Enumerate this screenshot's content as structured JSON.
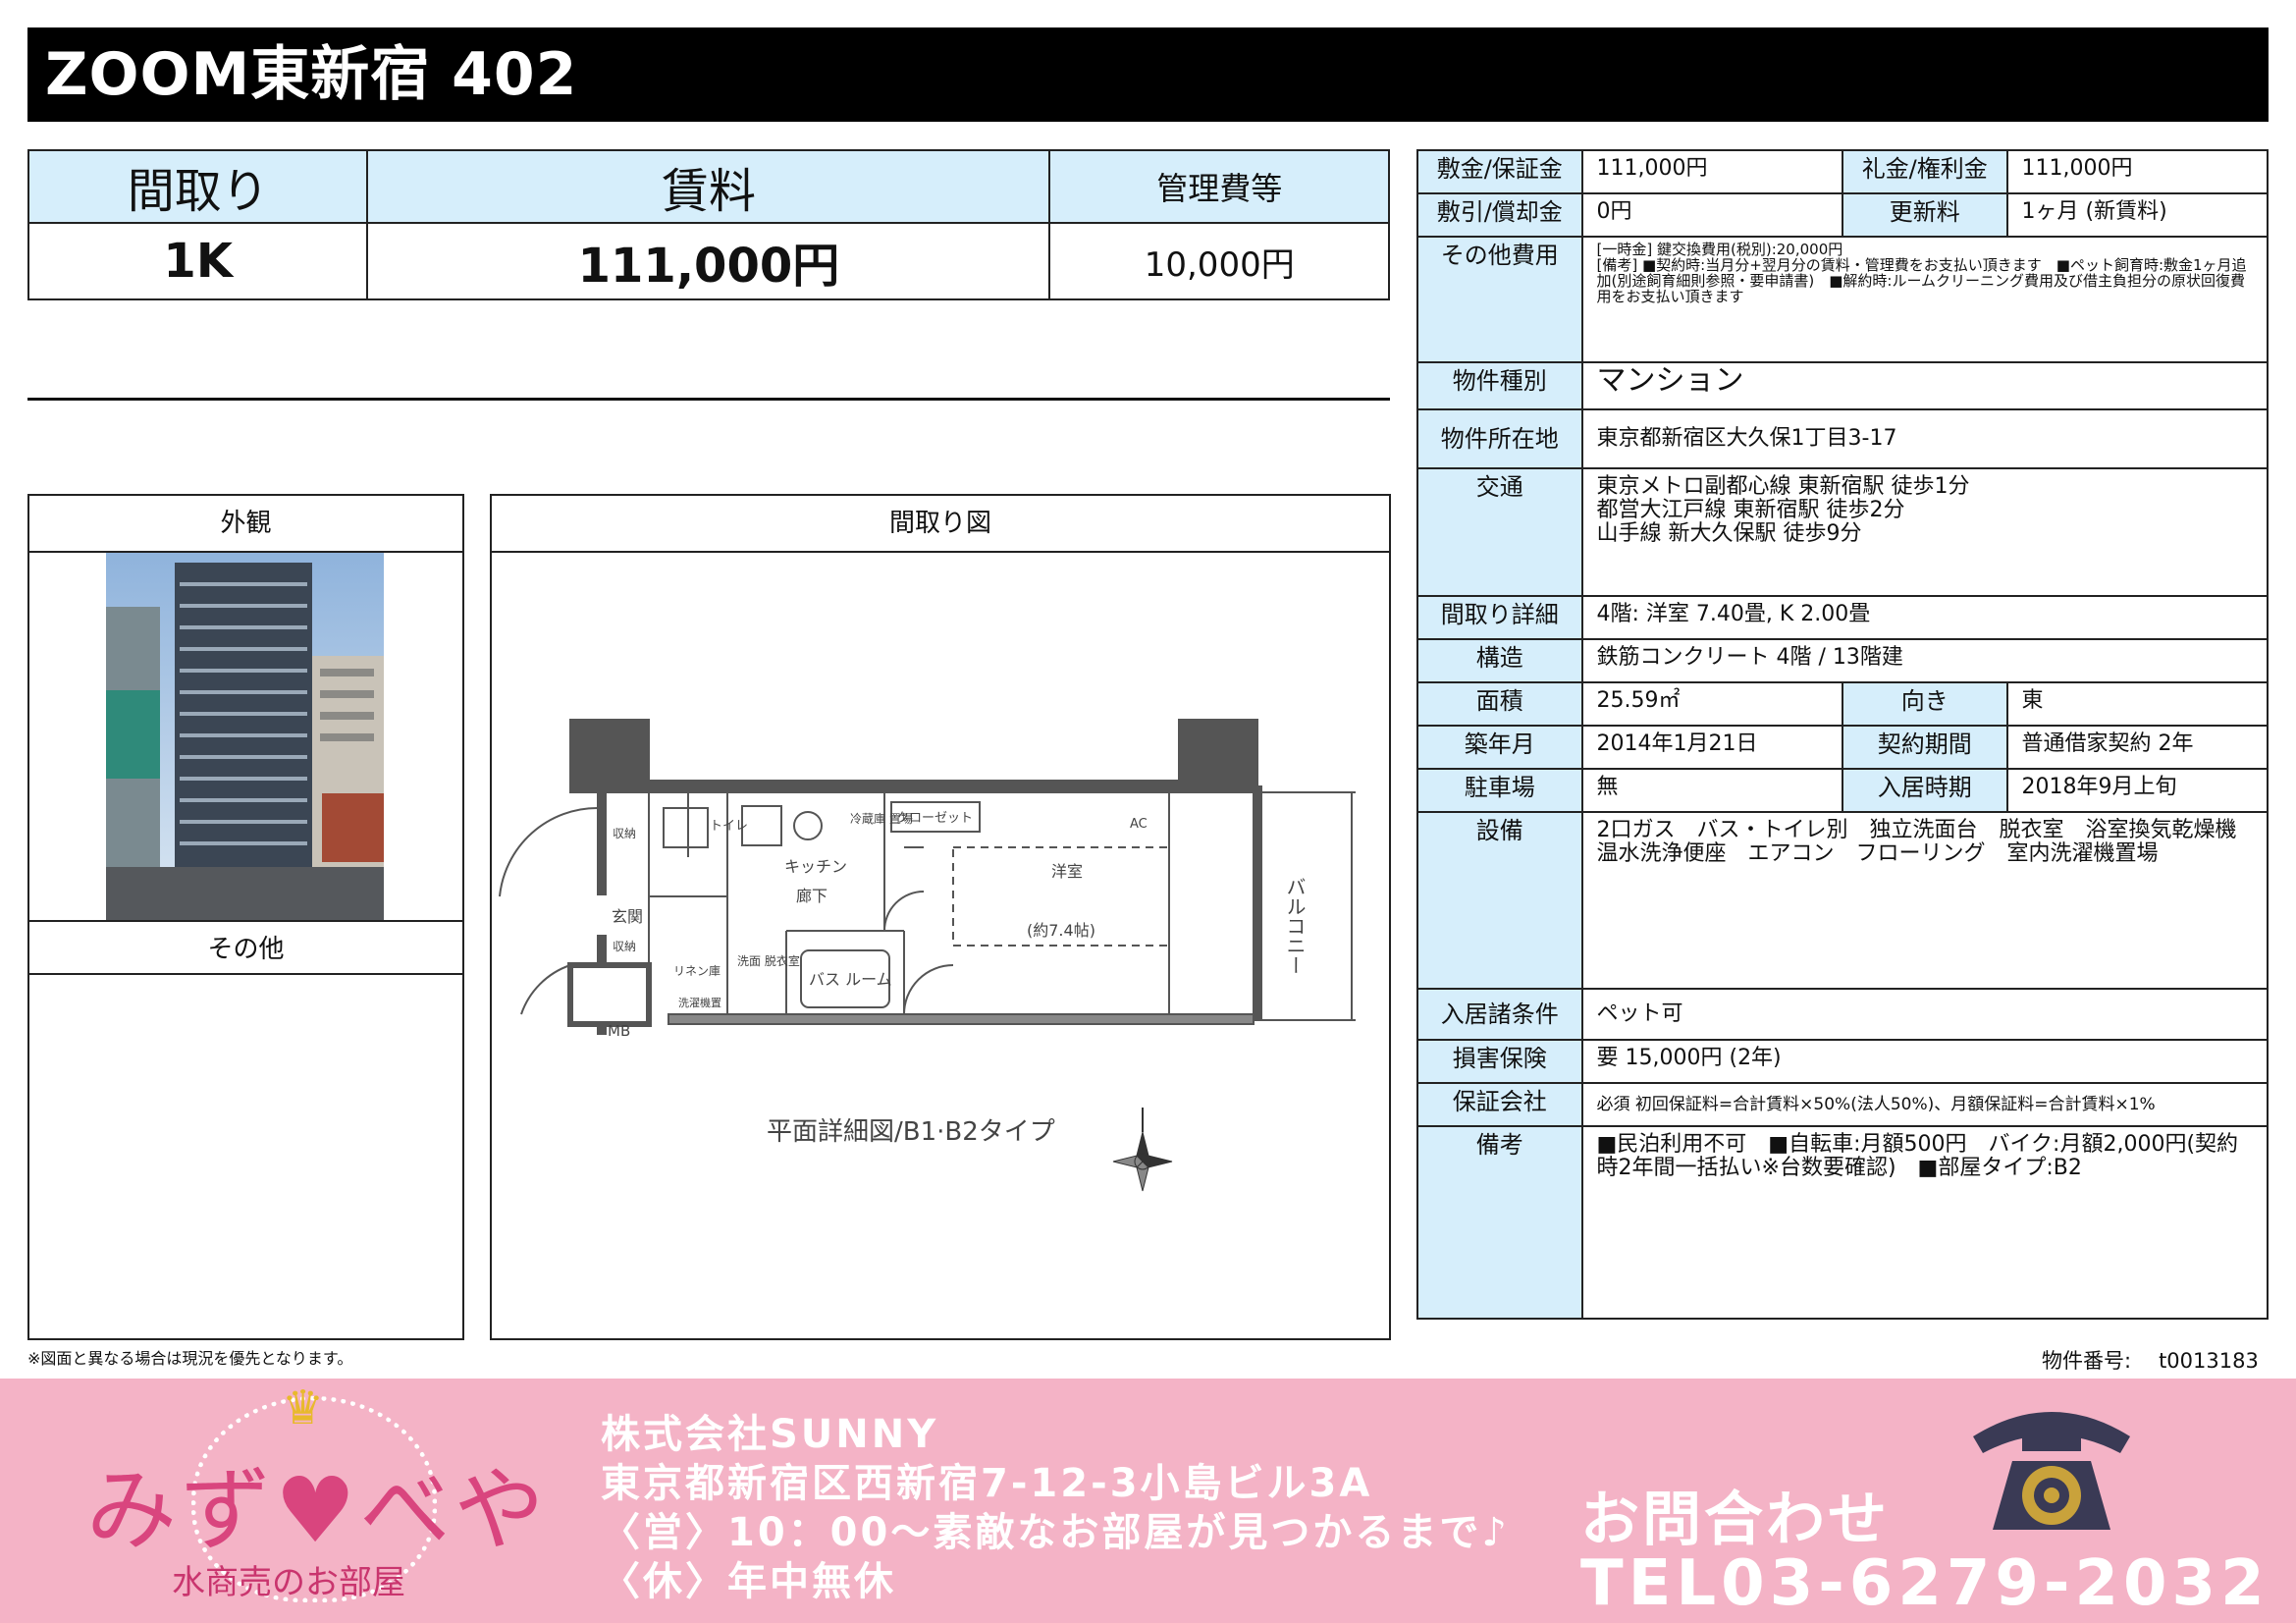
{
  "title": "ZOOM東新宿 402",
  "price": {
    "layout_label": "間取り",
    "rent_label": "賃料",
    "fee_label": "管理費等",
    "layout_value": "1K",
    "rent_value": "111,000円",
    "fee_value": "10,000円"
  },
  "panels": {
    "exterior": "外観",
    "other": "その他",
    "floorplan": "間取り図"
  },
  "floorplan": {
    "caption": "平面詳細図/B1·B2タイプ",
    "labels": {
      "kitchen": "キッチン",
      "hall": "廊下",
      "western": "洋室",
      "western_size": "(約7.4帖)",
      "closet": "クローゼット",
      "bath": "バス\nルーム",
      "entrance": "玄関",
      "toilet": "トイレ",
      "balcony": "バルコニー",
      "mb": "MB",
      "storage1": "収納",
      "storage2": "収納",
      "fridge": "冷蔵庫\n置場",
      "linen": "リネン庫",
      "washroom": "洗面\n脱衣室",
      "washer": "洗濯機置",
      "ac": "AC"
    }
  },
  "note": "※図面と異なる場合は現況を優先となります。",
  "property_no_label": "物件番号:",
  "property_no": "t0013183",
  "details": {
    "deposit_label": "敷金/保証金",
    "deposit": "111,000円",
    "key_money_label": "礼金/権利金",
    "key_money": "111,000円",
    "deduction_label": "敷引/償却金",
    "deduction": "0円",
    "renewal_label": "更新料",
    "renewal": "1ヶ月 (新賃料)",
    "other_cost_label": "その他費用",
    "other_cost_1": "[一時金] 鍵交換費用(税別):20,000円",
    "other_cost_2": "[備考] ■契約時:当月分+翌月分の賃料・管理費をお支払い頂きます　■ペット飼育時:敷金1ヶ月追加(別途飼育細則参照・要申請書)　■解約時:ルームクリーニング費用及び借主負担分の原状回復費用をお支払い頂きます",
    "type_label": "物件種別",
    "type": "マンション",
    "location_label": "物件所在地",
    "location": "東京都新宿区大久保1丁目3-17",
    "transport_label": "交通",
    "transport_1": "東京メトロ副都心線 東新宿駅 徒歩1分",
    "transport_2": "都営大江戸線 東新宿駅 徒歩2分",
    "transport_3": "山手線 新大久保駅 徒歩9分",
    "layout_detail_label": "間取り詳細",
    "layout_detail": "4階: 洋室 7.40畳, K 2.00畳",
    "structure_label": "構造",
    "structure": "鉄筋コンクリート 4階 / 13階建",
    "area_label": "面積",
    "area": "25.59㎡",
    "direction_label": "向き",
    "direction": "東",
    "built_label": "築年月",
    "built": "2014年1月21日",
    "contract_label": "契約期間",
    "contract": "普通借家契約 2年",
    "parking_label": "駐車場",
    "parking": "無",
    "move_in_label": "入居時期",
    "move_in": "2018年9月上旬",
    "equipment_label": "設備",
    "equipment": "2口ガス　バス・トイレ別　独立洗面台　脱衣室　浴室換気乾燥機　温水洗浄便座　エアコン　フローリング　室内洗濯機置場",
    "conditions_label": "入居諸条件",
    "conditions": "ペット可",
    "insurance_label": "損害保険",
    "insurance": "要 15,000円 (2年)",
    "guarantee_label": "保証会社",
    "guarantee": "必須 初回保証料=合計賃料×50%(法人50%)、月額保証料=合計賃料×1%",
    "remarks_label": "備考",
    "remarks": "■民泊利用不可　■自転車:月額500円　バイク:月額2,000円(契約時2年間一括払い※台数要確認)　■部屋タイプ:B2"
  },
  "footer": {
    "logo": "みず♥べや",
    "logo_sub": "水商売のお部屋",
    "company": "株式会社SUNNY",
    "address": "東京都新宿区西新宿7-12-3小島ビル3A",
    "hours": "〈営〉10：00～素敵なお部屋が見つかるまで♪",
    "holiday": "〈休〉年中無休",
    "inquiry": "お問合わせ",
    "tel": "TEL03-6279-2032"
  },
  "colors": {
    "header_bg": "#000000",
    "label_bg": "#d6eefb",
    "footer_bg": "#f4b3c6",
    "logo_pink": "#d9457e"
  }
}
